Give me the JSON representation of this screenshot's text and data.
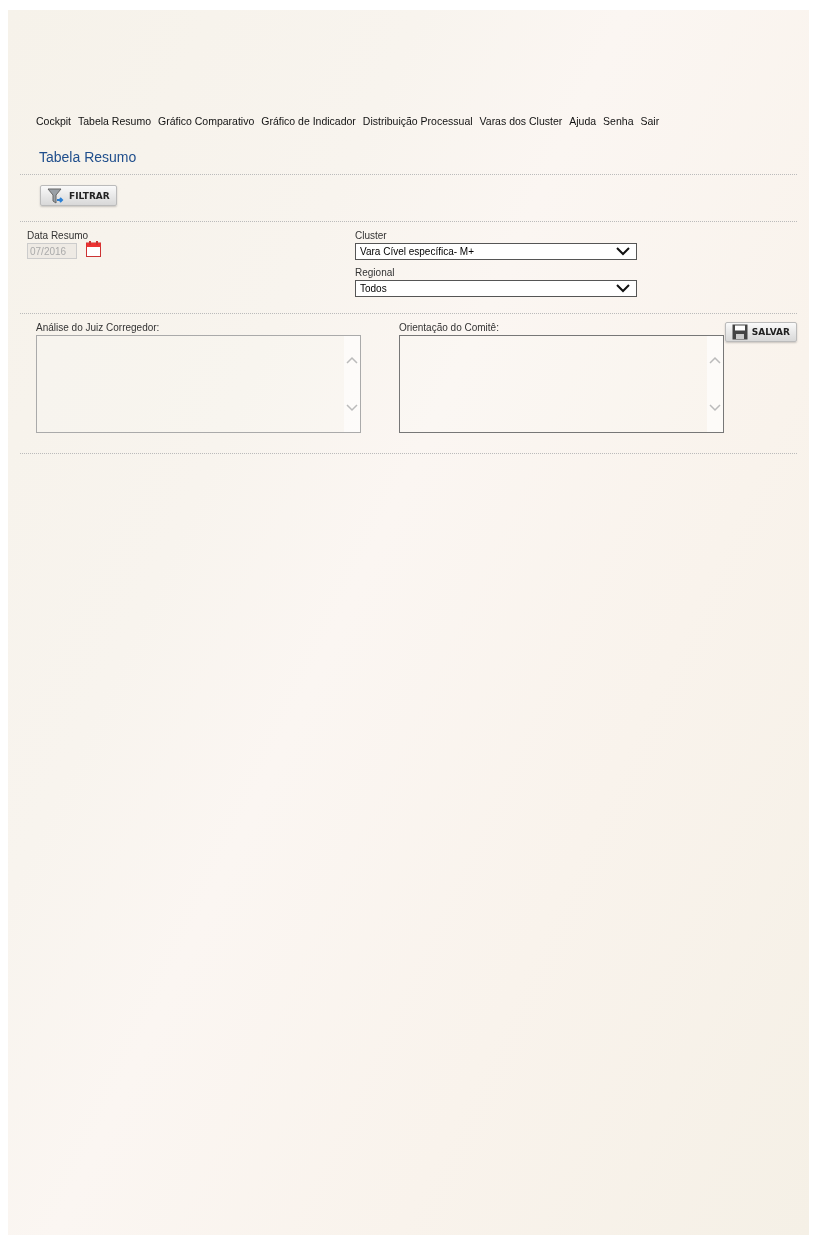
{
  "nav": [
    {
      "label": "Cockpit"
    },
    {
      "label": "Tabela Resumo"
    },
    {
      "label": "Gráfico Comparativo"
    },
    {
      "label": "Gráfico de Indicador"
    },
    {
      "label": "Distribuição Processual"
    },
    {
      "label": "Varas dos Cluster"
    },
    {
      "label": "Ajuda"
    },
    {
      "label": "Senha"
    },
    {
      "label": "Sair"
    }
  ],
  "page_title": "Tabela Resumo",
  "filter_button": "FILTRAR",
  "date_field": {
    "label": "Data Resumo",
    "value": "07/2016",
    "disabled": true
  },
  "cluster": {
    "label": "Cluster",
    "value": "Vara Cível específica- M+"
  },
  "regional": {
    "label": "Regional",
    "value": "Todos"
  },
  "analysis": {
    "label": "Análise do Juiz Corregedor:"
  },
  "guidance": {
    "label": "Orientação do Comitê:"
  },
  "save_button": "SALVAR"
}
